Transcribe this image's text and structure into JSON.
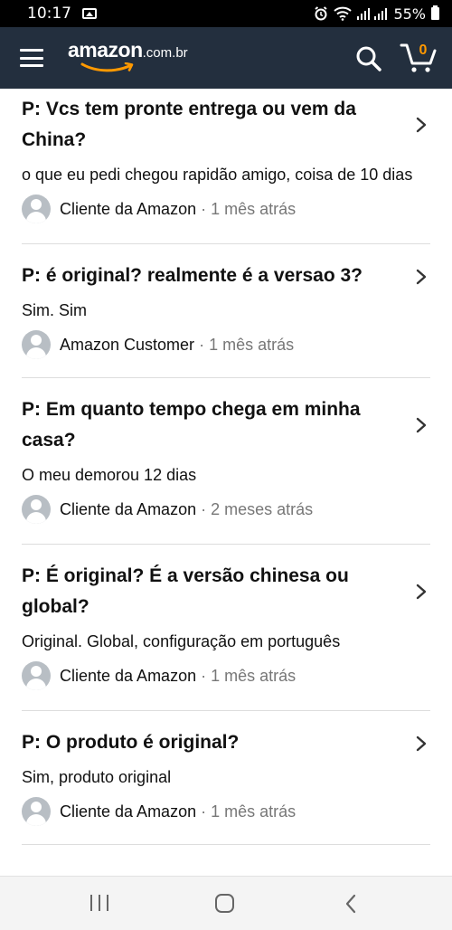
{
  "status_bar": {
    "time": "10:17",
    "battery": "55%",
    "icons": [
      "gallery-icon",
      "alarm-icon",
      "wifi-icon",
      "signal-icon",
      "battery-icon"
    ]
  },
  "header": {
    "logo_word": "amazon",
    "logo_suffix": ".com.br",
    "cart_count": "0",
    "background_color": "#232f3e",
    "accent_color": "#ff9900",
    "icons": [
      "menu-icon",
      "search-icon",
      "cart-icon"
    ]
  },
  "questions": [
    {
      "question": "P: Vcs tem pronte entrega ou vem da China?",
      "answer": "o que eu pedi chegou rapidão amigo, coisa de 10 dias",
      "author": "Cliente da Amazon",
      "separator": "·",
      "time": "1 mês atrás"
    },
    {
      "question": "P: é original? realmente é a versao 3?",
      "answer": "Sim. Sim",
      "author": "Amazon Customer",
      "separator": "·",
      "time": "1 mês atrás"
    },
    {
      "question": "P: Em quanto tempo chega em minha casa?",
      "answer": "O meu demorou 12 dias",
      "author": "Cliente da Amazon",
      "separator": "·",
      "time": "2 meses atrás"
    },
    {
      "question": "P: É original? É a versão chinesa ou global?",
      "answer": "Original. Global, configuração em português",
      "author": "Cliente da Amazon",
      "separator": "·",
      "time": "1 mês atrás"
    },
    {
      "question": "P: O produto é original?",
      "answer": "Sim, produto original",
      "author": "Cliente da Amazon",
      "separator": "·",
      "time": "1 mês atrás"
    }
  ],
  "nav_bar": {
    "icons": [
      "recent-apps-icon",
      "home-icon",
      "back-icon"
    ]
  }
}
